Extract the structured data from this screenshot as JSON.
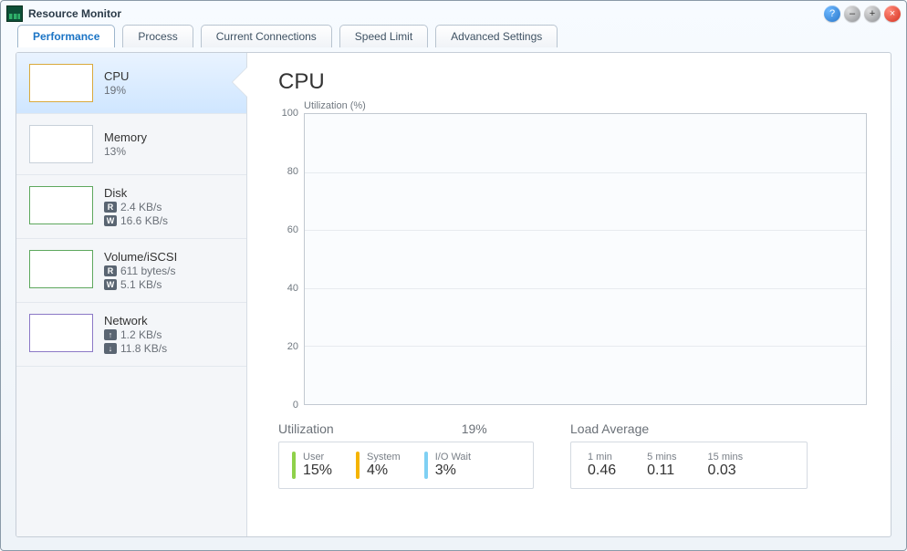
{
  "window": {
    "title": "Resource Monitor"
  },
  "tabs": [
    {
      "label": "Performance"
    },
    {
      "label": "Process"
    },
    {
      "label": "Current Connections"
    },
    {
      "label": "Speed Limit"
    },
    {
      "label": "Advanced Settings"
    }
  ],
  "sidebar": {
    "cpu": {
      "title": "CPU",
      "val": "19%"
    },
    "memory": {
      "title": "Memory",
      "val": "13%"
    },
    "disk": {
      "title": "Disk",
      "r_badge": "R",
      "r": "2.4 KB/s",
      "w_badge": "W",
      "w": "16.6 KB/s"
    },
    "volume": {
      "title": "Volume/iSCSI",
      "r_badge": "R",
      "r": "611 bytes/s",
      "w_badge": "W",
      "w": "5.1 KB/s"
    },
    "network": {
      "title": "Network",
      "up_badge": "↑",
      "up": "1.2 KB/s",
      "down_badge": "↓",
      "down": "11.8 KB/s"
    }
  },
  "main": {
    "title": "CPU",
    "chart_axis_label": "Utilization (%)",
    "util_label": "Utilization",
    "util_value": "19%",
    "user_label": "User",
    "user_value": "15%",
    "system_label": "System",
    "system_value": "4%",
    "io_label": "I/O Wait",
    "io_value": "3%",
    "load_label": "Load Average",
    "l1_label": "1 min",
    "l1_value": "0.46",
    "l5_label": "5 mins",
    "l5_value": "0.11",
    "l15_label": "15 mins",
    "l15_value": "0.03"
  },
  "chart_data": {
    "type": "line",
    "title": "CPU",
    "ylabel": "Utilization (%)",
    "ylim": [
      0,
      100
    ],
    "yticks": [
      0,
      20,
      40,
      60,
      80,
      100
    ],
    "series": [
      {
        "name": "CPU Utilization",
        "values": []
      }
    ]
  }
}
